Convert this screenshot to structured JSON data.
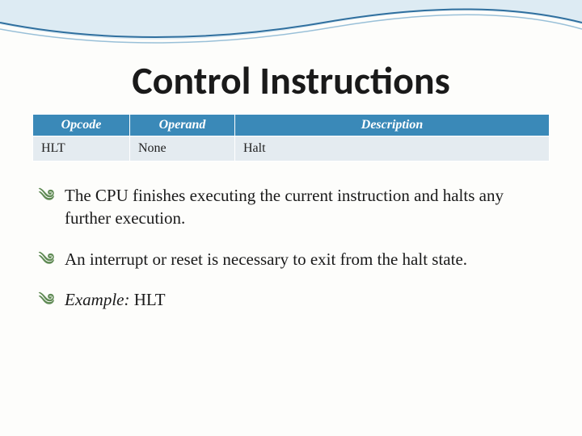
{
  "title": "Control Instructions",
  "table": {
    "headers": {
      "c1": "Opcode",
      "c2": "Operand",
      "c3": "Description"
    },
    "row": {
      "c1": "HLT",
      "c2": "None",
      "c3": "Halt"
    }
  },
  "bullets": {
    "b1": "The CPU finishes executing the current instruction and halts any further execution.",
    "b2": "An interrupt or reset is necessary to exit from the halt state.",
    "b3_label": "Example:",
    "b3_value": " HLT"
  },
  "icons": {
    "bullet_glyph": "༄"
  }
}
